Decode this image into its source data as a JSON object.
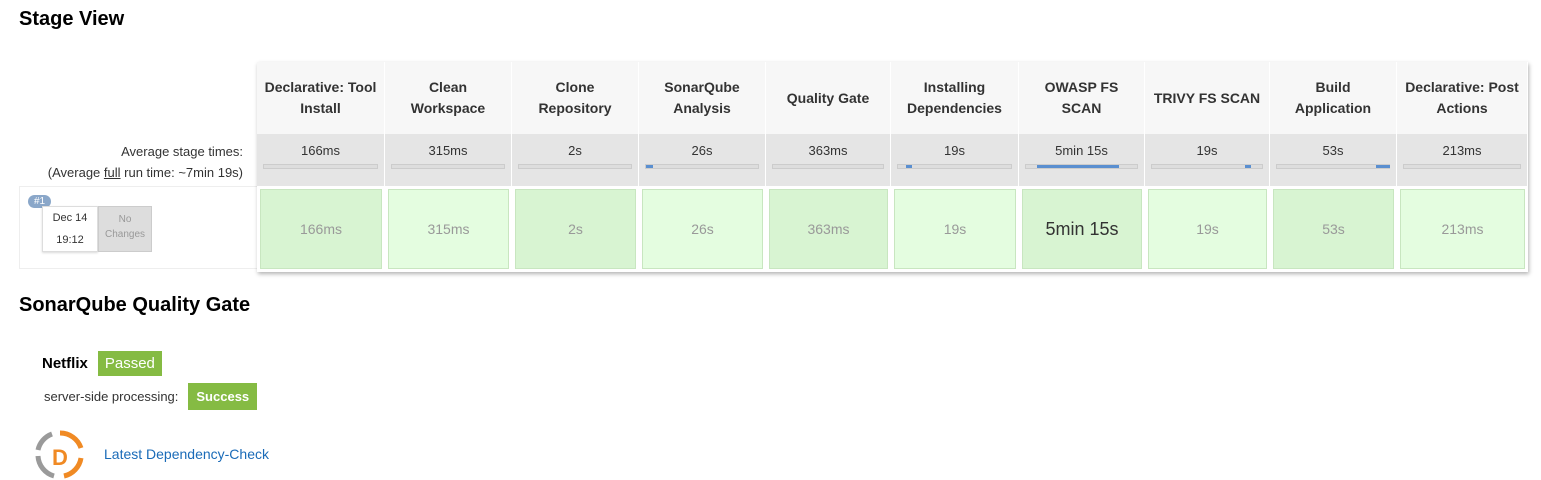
{
  "stage_view": {
    "title": "Stage View",
    "avg_label": "Average stage times:",
    "full_run_prefix": "(Average ",
    "full_run_word": "full",
    "full_run_suffix": " run time: ~7min 19s)",
    "stages": [
      {
        "name": "Declarative: Tool Install",
        "avg": "166ms",
        "run": "166ms",
        "progress": 0.0
      },
      {
        "name": "Clean Workspace",
        "avg": "315ms",
        "run": "315ms",
        "progress": 0.0
      },
      {
        "name": "Clone Repository",
        "avg": "2s",
        "run": "2s",
        "progress": 0.0
      },
      {
        "name": "SonarQube Analysis",
        "avg": "26s",
        "run": "26s",
        "progress": 0.06
      },
      {
        "name": "Quality Gate",
        "avg": "363ms",
        "run": "363ms",
        "progress": 0.0
      },
      {
        "name": "Installing Dependencies",
        "avg": "19s",
        "run": "19s",
        "progress": 0.05
      },
      {
        "name": "OWASP FS SCAN",
        "avg": "5min 15s",
        "run": "5min 15s",
        "progress": 0.72
      },
      {
        "name": "TRIVY FS SCAN",
        "avg": "19s",
        "run": "19s",
        "progress": 0.05
      },
      {
        "name": "Build Application",
        "avg": "53s",
        "run": "53s",
        "progress": 0.12
      },
      {
        "name": "Declarative: Post Actions",
        "avg": "213ms",
        "run": "213ms",
        "progress": 0.0
      }
    ],
    "run": {
      "badge": "#1",
      "date": "Dec 14",
      "time": "19:12",
      "changes": "No Changes"
    }
  },
  "quality_gate": {
    "title": "SonarQube Quality Gate",
    "project": "Netflix",
    "status": "Passed",
    "server_label": "server-side processing:",
    "server_status": "Success",
    "status_color": "#85bb43"
  },
  "dependency_check": {
    "logo_letter": "D",
    "link": "Latest Dependency-Check"
  }
}
